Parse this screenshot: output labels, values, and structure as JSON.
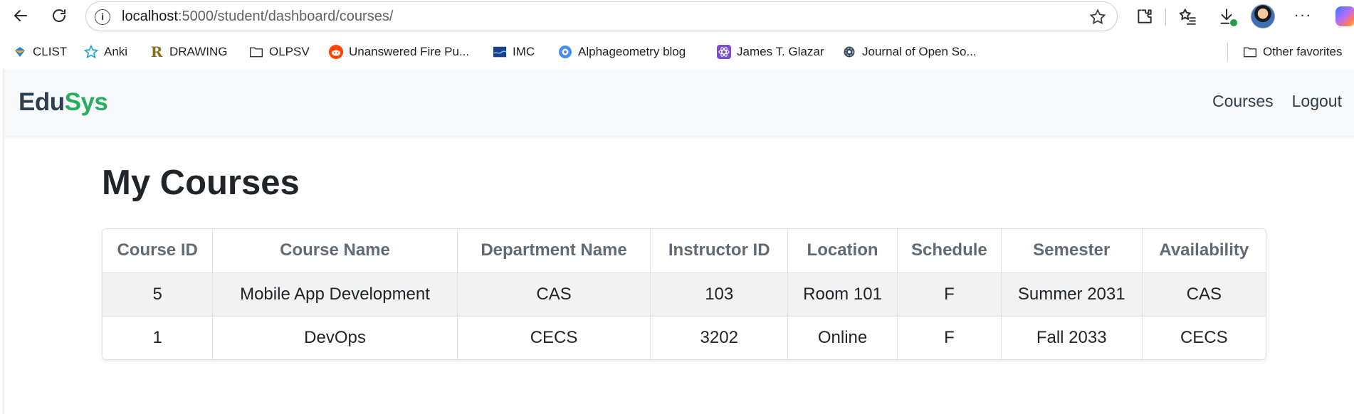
{
  "browser": {
    "url_host": "localhost",
    "url_path": ":5000/student/dashboard/courses/",
    "bookmarks": [
      {
        "label": "CLIST",
        "icon": "clist-icon"
      },
      {
        "label": "Anki",
        "icon": "anki-star-icon"
      },
      {
        "label": "DRAWING",
        "icon": "r-letter-icon"
      },
      {
        "label": "OLPSV",
        "icon": "folder-icon"
      },
      {
        "label": "Unanswered Fire Pu...",
        "icon": "reddit-icon"
      },
      {
        "label": "IMC",
        "icon": "imc-icon"
      },
      {
        "label": "Alphageometry blog",
        "icon": "swirl-icon"
      },
      {
        "label": "James T. Glazar",
        "icon": "react-icon"
      },
      {
        "label": "Journal of Open So...",
        "icon": "gear-icon"
      }
    ],
    "other_favorites": "Other favorites"
  },
  "app": {
    "brand_part1": "Edu",
    "brand_part2": "Sys",
    "nav": {
      "courses": "Courses",
      "logout": "Logout"
    },
    "colors": {
      "brand_dark": "#2c3e50",
      "brand_green": "#27ae60"
    }
  },
  "main": {
    "title": "My Courses",
    "table": {
      "headers": [
        "Course ID",
        "Course Name",
        "Department Name",
        "Instructor ID",
        "Location",
        "Schedule",
        "Semester",
        "Availability"
      ],
      "rows": [
        [
          "5",
          "Mobile App Development",
          "CAS",
          "103",
          "Room 101",
          "F",
          "Summer 2031",
          "CAS"
        ],
        [
          "1",
          "DevOps",
          "CECS",
          "3202",
          "Online",
          "F",
          "Fall 2033",
          "CECS"
        ]
      ]
    }
  }
}
